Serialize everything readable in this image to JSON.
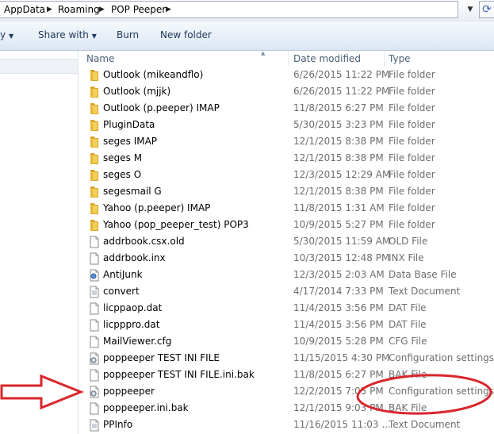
{
  "address": {
    "crumbs": [
      "AppData",
      "Roaming",
      "POP Peeper"
    ]
  },
  "toolbar": {
    "organize_partial": "y",
    "share_label": "Share with",
    "burn_label": "Burn",
    "newfolder_label": "New folder"
  },
  "columns": {
    "name": "Name",
    "date": "Date modified",
    "type": "Type"
  },
  "files": [
    {
      "name": "Outlook (mikeandflo)",
      "date": "6/26/2015 11:22 PM",
      "type": "File folder",
      "icon": "folder-icon"
    },
    {
      "name": "Outlook (mjjk)",
      "date": "6/26/2015 11:22 PM",
      "type": "File folder",
      "icon": "folder-icon"
    },
    {
      "name": "Outlook (p.peeper) IMAP",
      "date": "11/8/2015 6:27 PM",
      "type": "File folder",
      "icon": "folder-icon"
    },
    {
      "name": "PluginData",
      "date": "5/30/2015 3:23 PM",
      "type": "File folder",
      "icon": "folder-icon"
    },
    {
      "name": "seges IMAP",
      "date": "12/1/2015 8:38 PM",
      "type": "File folder",
      "icon": "folder-icon"
    },
    {
      "name": "seges M",
      "date": "12/1/2015 8:38 PM",
      "type": "File folder",
      "icon": "folder-icon"
    },
    {
      "name": "seges O",
      "date": "12/3/2015 12:29 AM",
      "type": "File folder",
      "icon": "folder-icon"
    },
    {
      "name": "segesmail G",
      "date": "12/1/2015 8:38 PM",
      "type": "File folder",
      "icon": "folder-icon"
    },
    {
      "name": "Yahoo (p.peeper) IMAP",
      "date": "11/8/2015 1:31 AM",
      "type": "File folder",
      "icon": "folder-icon"
    },
    {
      "name": "Yahoo (pop_peeper_test) POP3",
      "date": "10/9/2015 5:27 PM",
      "type": "File folder",
      "icon": "folder-icon"
    },
    {
      "name": "addrbook.csx.old",
      "date": "5/30/2015 11:59 AM",
      "type": "OLD File",
      "icon": "file-icon"
    },
    {
      "name": "addrbook.inx",
      "date": "10/3/2015 12:48 PM",
      "type": "INX File",
      "icon": "file-icon"
    },
    {
      "name": "AntiJunk",
      "date": "12/3/2015 2:03 AM",
      "type": "Data Base File",
      "icon": "database-file-icon"
    },
    {
      "name": "convert",
      "date": "4/17/2014 7:33 PM",
      "type": "Text Document",
      "icon": "text-file-icon"
    },
    {
      "name": "licppaop.dat",
      "date": "11/4/2015 3:56 PM",
      "type": "DAT File",
      "icon": "file-icon"
    },
    {
      "name": "licpppro.dat",
      "date": "11/4/2015 3:56 PM",
      "type": "DAT File",
      "icon": "file-icon"
    },
    {
      "name": "MailViewer.cfg",
      "date": "10/9/2015 5:28 PM",
      "type": "CFG File",
      "icon": "file-icon"
    },
    {
      "name": "poppeeper TEST INI FILE",
      "date": "11/15/2015 4:30 PM",
      "type": "Configuration settings",
      "icon": "settings-file-icon"
    },
    {
      "name": "poppeeper TEST INI FILE.ini.bak",
      "date": "11/8/2015 6:27 PM",
      "type": "BAK File",
      "icon": "file-icon"
    },
    {
      "name": "poppeeper",
      "date": "12/2/2015 7:05 PM",
      "type": "Configuration settings",
      "icon": "settings-file-icon"
    },
    {
      "name": "poppeeper.ini.bak",
      "date": "12/1/2015 9:03 PM",
      "type": "BAK File",
      "icon": "file-icon"
    },
    {
      "name": "PPInfo",
      "date": "11/16/2015 11:03 ...",
      "type": "Text Document",
      "icon": "text-file-icon"
    }
  ],
  "annotations": {
    "arrow_color": "#d9262c",
    "ellipse_color": "#d9262c"
  }
}
